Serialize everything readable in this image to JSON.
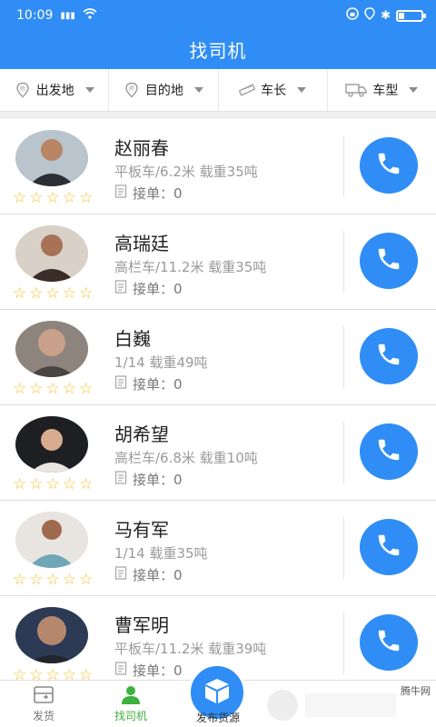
{
  "status_bar": {
    "time": "10:09",
    "signal": "4G",
    "battery": "battery"
  },
  "title": "找司机",
  "filters": [
    {
      "label": "出发地",
      "icon": "start-location-icon"
    },
    {
      "label": "目的地",
      "icon": "destination-icon"
    },
    {
      "label": "车长",
      "icon": "ruler-icon"
    },
    {
      "label": "车型",
      "icon": "truck-icon"
    }
  ],
  "drivers": [
    {
      "name": "赵丽春",
      "info": "平板车/6.2米 载重35吨",
      "orders": "接单：0",
      "rating": 0
    },
    {
      "name": "高瑞廷",
      "info": "高栏车/11.2米 载重35吨",
      "orders": "接单：0",
      "rating": 0
    },
    {
      "name": "白巍",
      "info": "1/14 载重49吨",
      "orders": "接单：0",
      "rating": 0
    },
    {
      "name": "胡希望",
      "info": "高栏车/6.8米 载重10吨",
      "orders": "接单：0",
      "rating": 0
    },
    {
      "name": "马有军",
      "info": "1/14 载重35吨",
      "orders": "接单：0",
      "rating": 0
    },
    {
      "name": "曹军明",
      "info": "平板车/11.2米 载重39吨",
      "orders": "接单：0",
      "rating": 0
    }
  ],
  "tabs": [
    {
      "label": "发货",
      "icon": "ship-goods-icon"
    },
    {
      "label": "找司机",
      "icon": "find-driver-icon"
    },
    {
      "label": "发布货源",
      "icon": "publish-cargo-icon"
    }
  ],
  "watermark": "腾牛网",
  "colors": {
    "primary": "#2f8df5",
    "active_tab": "#3db13d",
    "star": "#f5c026"
  }
}
